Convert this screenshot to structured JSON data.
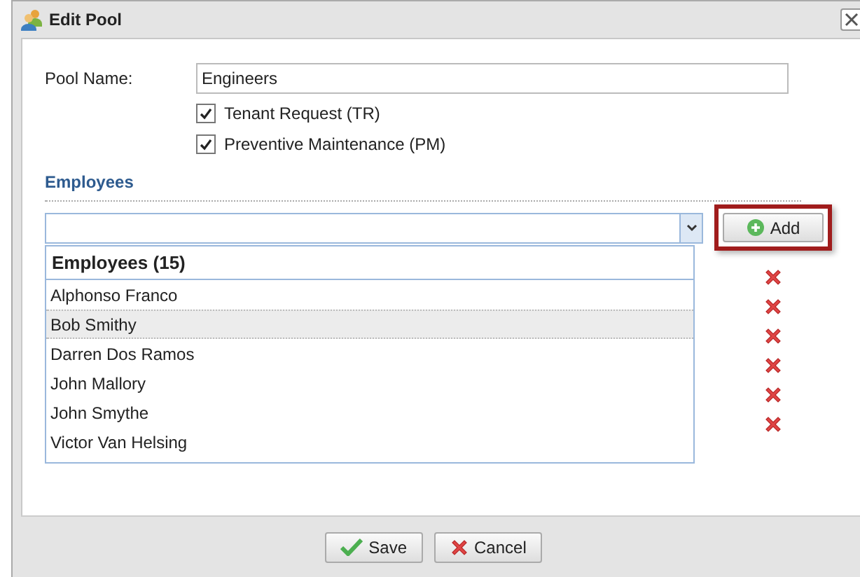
{
  "window": {
    "title": "Edit Pool"
  },
  "form": {
    "pool_name_label": "Pool Name:",
    "pool_name_value": "Engineers",
    "checkboxes": [
      {
        "label": "Tenant Request (TR)",
        "checked": true
      },
      {
        "label": "Preventive Maintenance (PM)",
        "checked": true
      }
    ]
  },
  "employees": {
    "heading": "Employees",
    "add_button": "Add",
    "dropdown_header": "Employees (15)",
    "options": [
      {
        "name": "Alphonso Franco",
        "highlighted": false
      },
      {
        "name": "Bob Smithy",
        "highlighted": true
      },
      {
        "name": "Darren Dos Ramos",
        "highlighted": false
      },
      {
        "name": "John Mallory",
        "highlighted": false
      },
      {
        "name": "John Smythe",
        "highlighted": false
      },
      {
        "name": "Victor Van Helsing",
        "highlighted": false
      }
    ]
  },
  "buttons": [
    {
      "label": "Save",
      "kind": "save"
    },
    {
      "label": "Cancel",
      "kind": "cancel"
    }
  ]
}
